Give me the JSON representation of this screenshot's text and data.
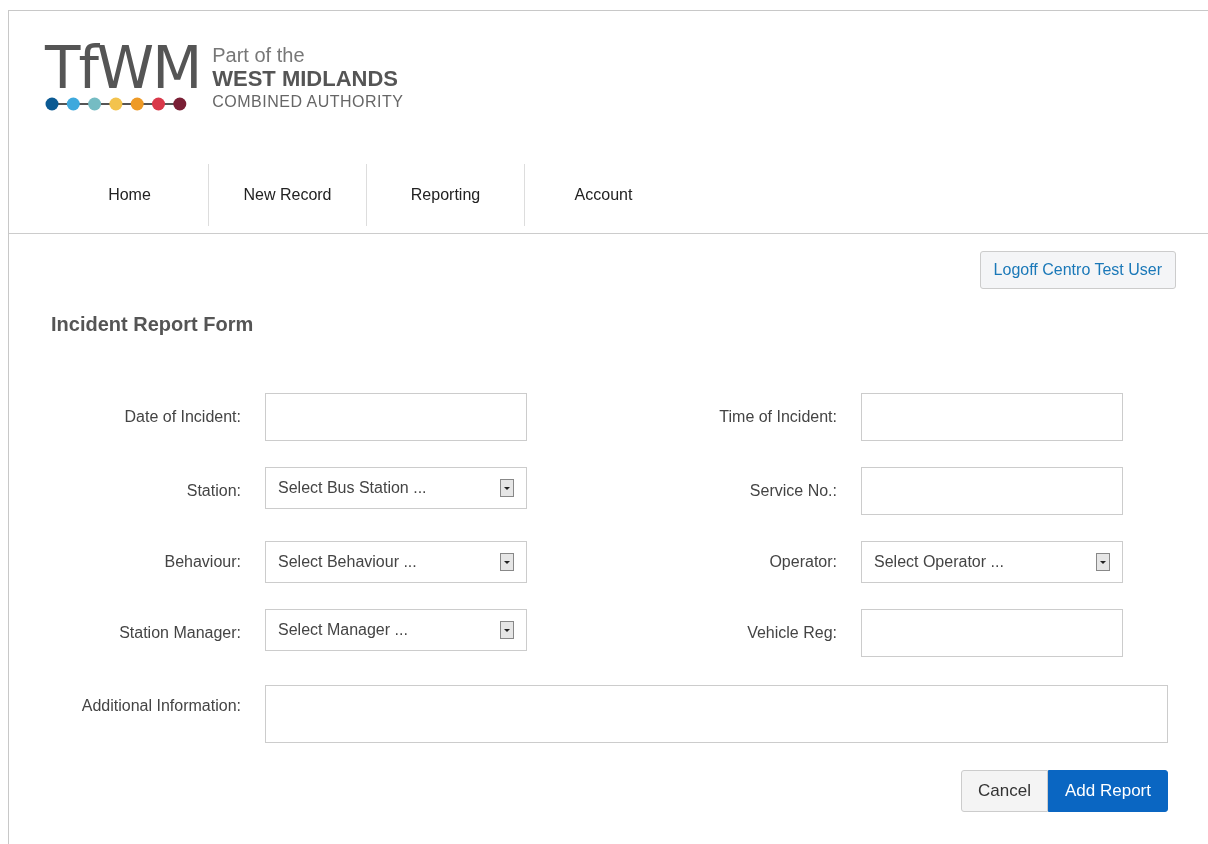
{
  "logo": {
    "mark": "TfWM",
    "line_1": "Part of the",
    "line_2": "WEST MIDLANDS",
    "line_3": "COMBINED AUTHORITY"
  },
  "nav": [
    {
      "label": "Home"
    },
    {
      "label": "New Record"
    },
    {
      "label": "Reporting"
    },
    {
      "label": "Account"
    }
  ],
  "logoff_button": "Logoff Centro Test User",
  "form": {
    "title": "Incident Report Form",
    "rows": [
      [
        {
          "label": "Date of Incident:",
          "kind": "text"
        },
        {
          "label": "Time of Incident:",
          "kind": "text"
        }
      ],
      [
        {
          "label": "Station:",
          "kind": "select",
          "placeholder": "Select Bus Station ..."
        },
        {
          "label": "Service No.:",
          "kind": "text"
        }
      ],
      [
        {
          "label": "Behaviour:",
          "kind": "select",
          "placeholder": "Select Behaviour ..."
        },
        {
          "label": "Operator:",
          "kind": "select",
          "placeholder": "Select Operator ..."
        }
      ],
      [
        {
          "label": "Station Manager:",
          "kind": "select",
          "placeholder": "Select Manager ..."
        },
        {
          "label": "Vehicle Reg:",
          "kind": "text"
        }
      ]
    ],
    "additional": {
      "label": "Additional Information:"
    },
    "buttons": [
      {
        "label": "Cancel",
        "kind": "secondary"
      },
      {
        "label": "Add Report",
        "kind": "primary"
      }
    ]
  }
}
